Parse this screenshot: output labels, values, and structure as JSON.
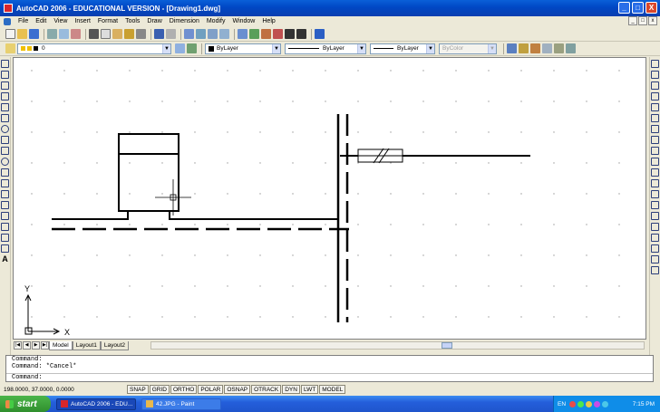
{
  "window": {
    "title": "AutoCAD 2006 - EDUCATIONAL VERSION - [Drawing1.dwg]",
    "buttons": [
      "_",
      "□",
      "X"
    ]
  },
  "menu": {
    "items": [
      "File",
      "Edit",
      "View",
      "Insert",
      "Format",
      "Tools",
      "Draw",
      "Dimension",
      "Modify",
      "Window",
      "Help"
    ],
    "doc_buttons": [
      "_",
      "□",
      "x"
    ]
  },
  "properties": {
    "layer": "0",
    "color": "ByLayer",
    "linetype": "ByLayer",
    "lineweight": "ByLayer",
    "plotstyle": "ByColor"
  },
  "layout_tabs": [
    "Model",
    "Layout1",
    "Layout2"
  ],
  "ucs": {
    "x_label": "X",
    "y_label": "Y"
  },
  "command": {
    "history": [
      "Command:",
      "Command: *Cancel*"
    ],
    "prompt": "Command:"
  },
  "status": {
    "coordinates": "198.0000, 37.0000, 0.0000",
    "toggles": [
      "SNAP",
      "GRID",
      "ORTHO",
      "POLAR",
      "OSNAP",
      "OTRACK",
      "DYN",
      "LWT",
      "MODEL"
    ]
  },
  "taskbar": {
    "start": "start",
    "tasks": [
      "AutoCAD 2006 - EDU...",
      "42.JPG - Paint"
    ],
    "language": "EN",
    "time": "7:15 PM"
  },
  "colors": {
    "titlebar": "#0047c4",
    "taskbar": "#245edb",
    "start": "#2f8f2d",
    "canvas": "#ffffff"
  }
}
